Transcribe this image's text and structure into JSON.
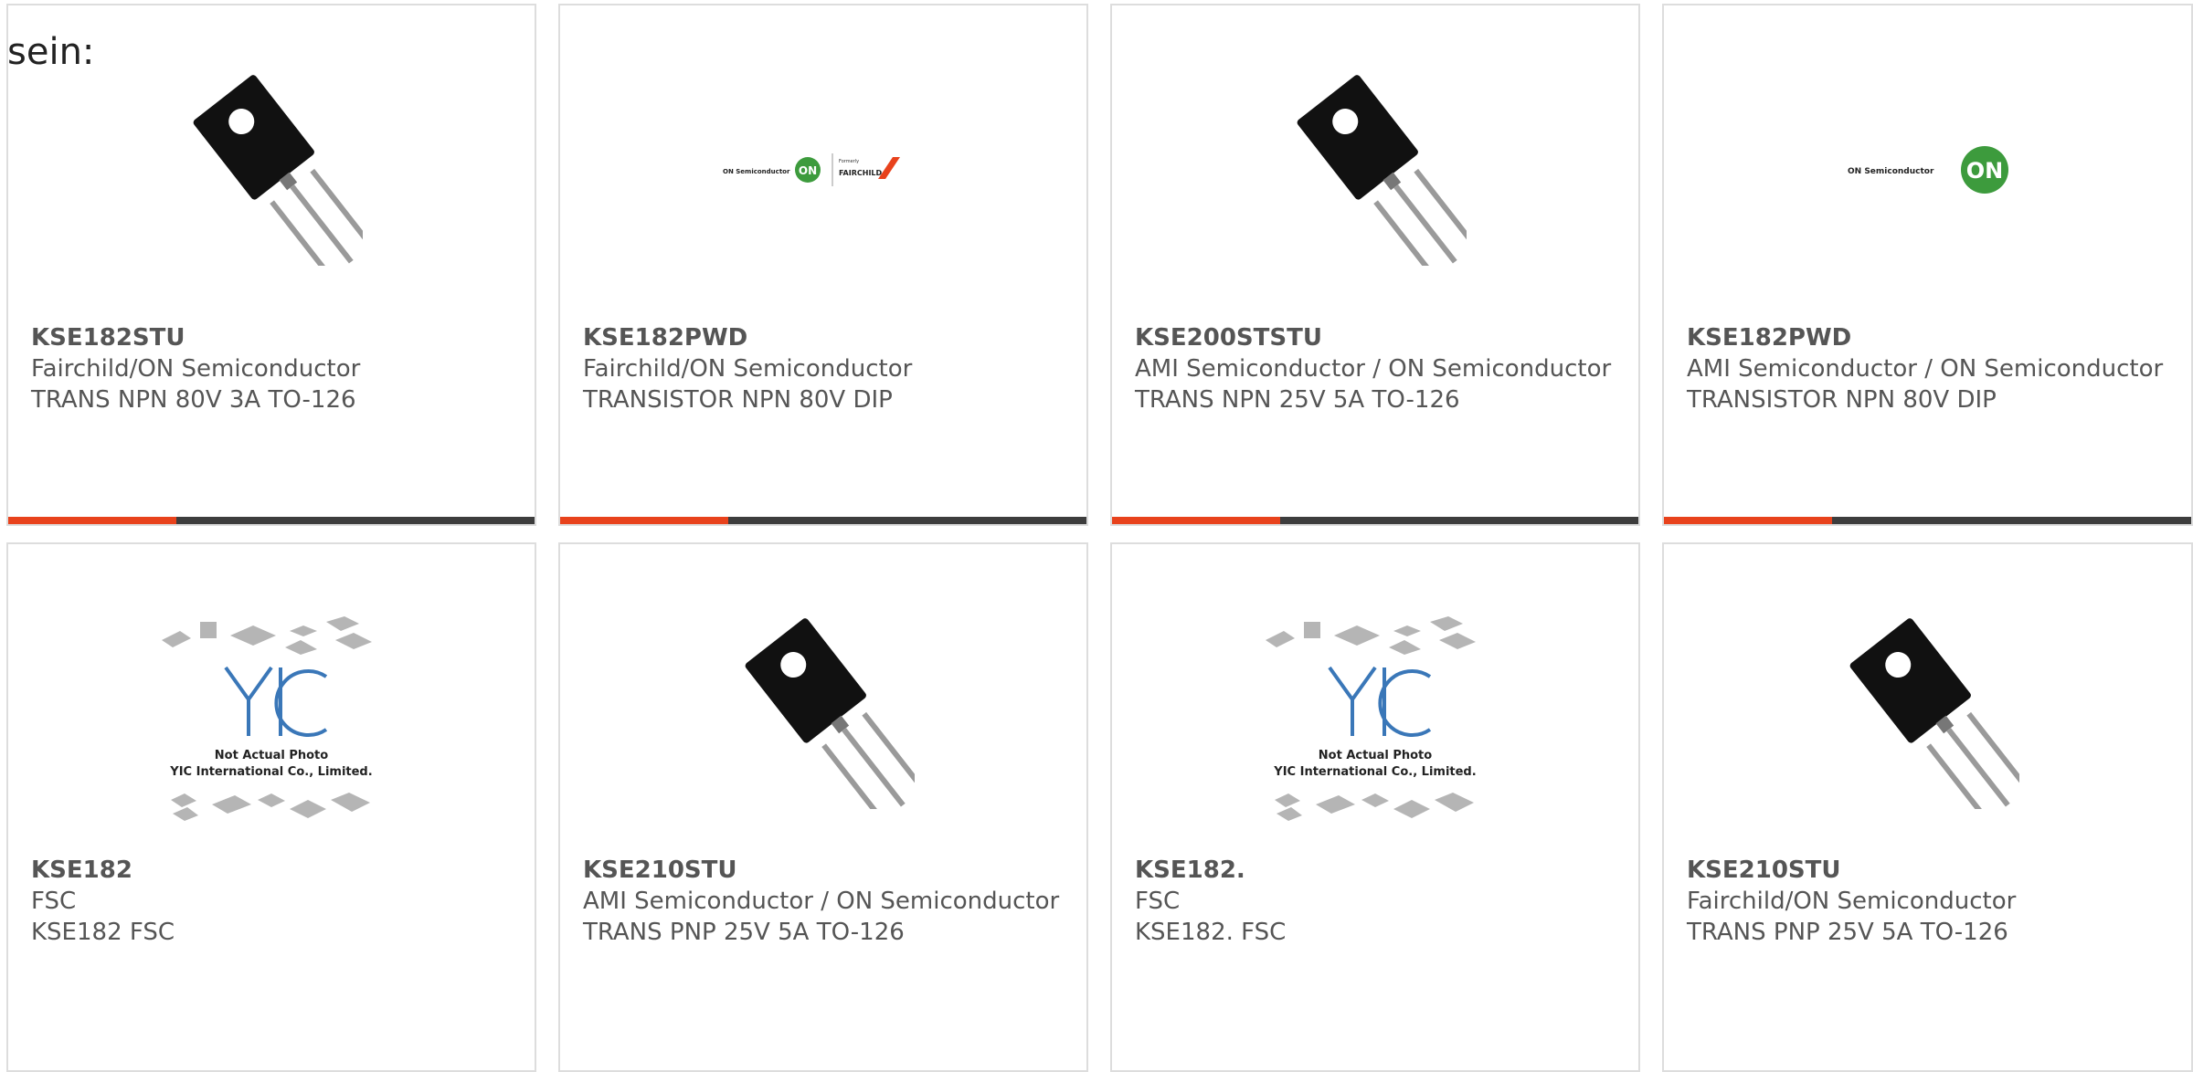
{
  "intro_text": "sein:",
  "accent_color": "#e8421c",
  "bar_color": "#3d3d3d",
  "products": [
    {
      "part": "KSE182STU",
      "maker": "Fairchild/ON Semiconductor",
      "desc": "TRANS NPN 80V 3A TO-126",
      "image": "to126-transistor"
    },
    {
      "part": "KSE182PWD",
      "maker": "Fairchild/ON Semiconductor",
      "desc": "TRANSISTOR NPN 80V DIP",
      "image": "on-fairchild-logo",
      "logo_left": "ON Semiconductor",
      "logo_badge": "ON",
      "logo_formerly": "Formerly",
      "logo_right": "FAIRCHILD"
    },
    {
      "part": "KSE200STSTU",
      "maker": "AMI Semiconductor / ON Semiconductor",
      "desc": "TRANS NPN 25V 5A TO-126",
      "image": "to126-transistor"
    },
    {
      "part": "KSE182PWD",
      "maker": "AMI Semiconductor / ON Semiconductor",
      "desc": "TRANSISTOR NPN 80V DIP",
      "image": "on-semi-logo",
      "logo_left": "ON Semiconductor",
      "logo_badge": "ON"
    },
    {
      "part": "KSE182",
      "maker": "FSC",
      "desc": "KSE182 FSC",
      "image": "yic-placeholder",
      "ph_line1": "Not Actual Photo",
      "ph_line2": "YIC International Co., Limited."
    },
    {
      "part": "KSE210STU",
      "maker": "AMI Semiconductor / ON Semiconductor",
      "desc": "TRANS PNP 25V 5A TO-126",
      "image": "to126-transistor"
    },
    {
      "part": "KSE182.",
      "maker": "FSC",
      "desc": "KSE182. FSC",
      "image": "yic-placeholder",
      "ph_line1": "Not Actual Photo",
      "ph_line2": "YIC International Co., Limited."
    },
    {
      "part": "KSE210STU",
      "maker": "Fairchild/ON Semiconductor",
      "desc": "TRANS PNP 25V 5A TO-126",
      "image": "to126-transistor"
    }
  ]
}
